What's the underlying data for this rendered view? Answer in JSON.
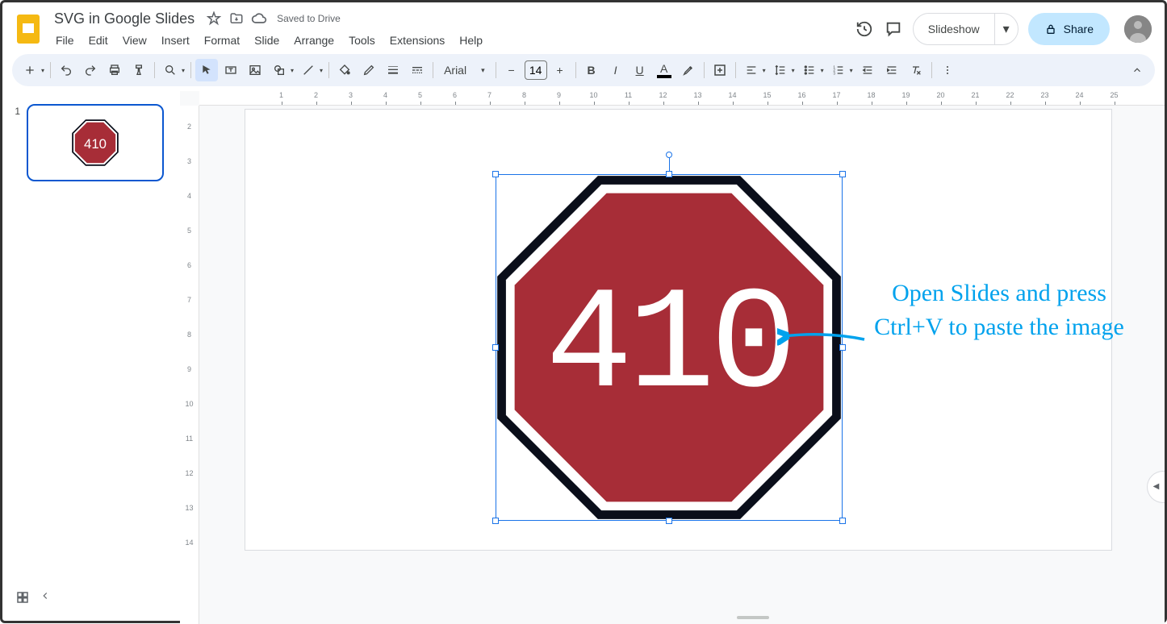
{
  "doc": {
    "title": "SVG in Google Slides",
    "save_status": "Saved to Drive"
  },
  "menu": {
    "file": "File",
    "edit": "Edit",
    "view": "View",
    "insert": "Insert",
    "format": "Format",
    "slide": "Slide",
    "arrange": "Arrange",
    "tools": "Tools",
    "extensions": "Extensions",
    "help": "Help"
  },
  "header": {
    "slideshow": "Slideshow",
    "share": "Share"
  },
  "toolbar": {
    "font_name": "Arial",
    "font_size": "14",
    "text_color_swatch": "#000000",
    "highlight_color_swatch": "#ffffff"
  },
  "filmstrip": {
    "slides": [
      {
        "number": "1",
        "thumb_text": "410"
      }
    ]
  },
  "canvas": {
    "ruler_h": [
      "1",
      "2",
      "3",
      "4",
      "5",
      "6",
      "7",
      "8",
      "9",
      "10",
      "11",
      "12",
      "13",
      "14",
      "15",
      "16",
      "17",
      "18",
      "19",
      "20",
      "21",
      "22",
      "23",
      "24",
      "25"
    ],
    "ruler_v": [
      "2",
      "3",
      "4",
      "5",
      "6",
      "7",
      "8",
      "9",
      "10",
      "11",
      "12",
      "13",
      "14"
    ],
    "octagon": {
      "text": "410",
      "fill": "#a72d37",
      "stroke": "#0a0e1a",
      "inner_stroke": "#ffffff"
    }
  },
  "annotation": {
    "text": "Open Slides and press Ctrl+V to paste the image",
    "color": "#00a2ed"
  }
}
